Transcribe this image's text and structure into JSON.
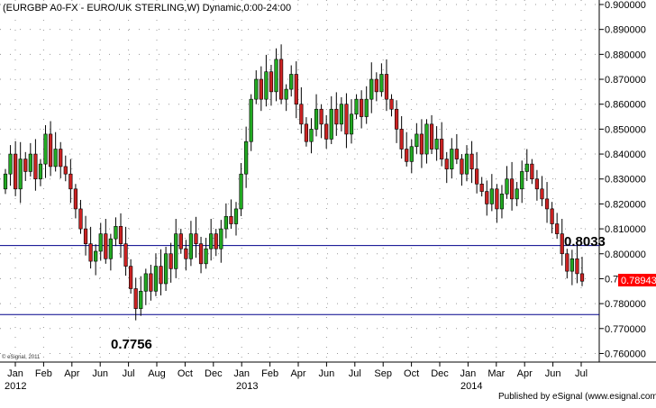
{
  "chart_data": {
    "type": "candlestick",
    "title": "(EURGBP A0-FX - EURO/UK STERLING,W) Dynamic,0:00-24:00",
    "ylim": [
      0.758,
      0.9
    ],
    "y_ticks": [
      "0.900000",
      "0.890000",
      "0.880000",
      "0.870000",
      "0.860000",
      "0.850000",
      "0.840000",
      "0.830000",
      "0.820000",
      "0.810000",
      "0.800000",
      "0.790000",
      "0.780000",
      "0.770000",
      "0.760000"
    ],
    "x_month_labels": [
      "Jan",
      "Feb",
      "Apr",
      "Jun",
      "Jul",
      "Aug",
      "Oct",
      "Dec",
      "Jan",
      "Feb",
      "Apr",
      "Jun",
      "Jul",
      "Sep",
      "Oct",
      "Dec",
      "Jan",
      "Mar",
      "Apr",
      "Jun",
      "Jul"
    ],
    "x_year_labels": [
      "2012",
      "2013",
      "2014"
    ],
    "horizontal_lines": [
      {
        "value": 0.8033,
        "label": "0.8033",
        "color": "#00008b"
      },
      {
        "value": 0.7756,
        "label": "0.7756",
        "color": "#00008b"
      }
    ],
    "last_price": {
      "value": 0.78943,
      "label": "0.78943",
      "color": "#ff0000"
    },
    "up_color": "#22aa22",
    "down_color": "#cc2222",
    "closes": [
      0.832,
      0.84,
      0.826,
      0.838,
      0.833,
      0.84,
      0.83,
      0.836,
      0.848,
      0.835,
      0.842,
      0.835,
      0.832,
      0.826,
      0.818,
      0.81,
      0.804,
      0.797,
      0.801,
      0.808,
      0.798,
      0.806,
      0.811,
      0.804,
      0.795,
      0.786,
      0.778,
      0.785,
      0.792,
      0.785,
      0.795,
      0.788,
      0.8,
      0.794,
      0.808,
      0.802,
      0.798,
      0.808,
      0.804,
      0.796,
      0.802,
      0.808,
      0.802,
      0.81,
      0.815,
      0.812,
      0.818,
      0.832,
      0.845,
      0.862,
      0.87,
      0.862,
      0.873,
      0.865,
      0.878,
      0.862,
      0.866,
      0.872,
      0.86,
      0.852,
      0.845,
      0.85,
      0.858,
      0.852,
      0.846,
      0.858,
      0.852,
      0.86,
      0.848,
      0.856,
      0.862,
      0.855,
      0.862,
      0.87,
      0.865,
      0.872,
      0.862,
      0.858,
      0.85,
      0.842,
      0.837,
      0.843,
      0.848,
      0.84,
      0.852,
      0.842,
      0.846,
      0.838,
      0.834,
      0.842,
      0.838,
      0.832,
      0.84,
      0.834,
      0.828,
      0.825,
      0.82,
      0.826,
      0.818,
      0.824,
      0.83,
      0.822,
      0.826,
      0.833,
      0.836,
      0.83,
      0.826,
      0.822,
      0.818,
      0.812,
      0.808,
      0.8,
      0.793,
      0.798,
      0.792,
      0.789
    ]
  },
  "watermark": "© eSignal, 2011",
  "publisher": "Published by eSignal (www.esignal.com)"
}
